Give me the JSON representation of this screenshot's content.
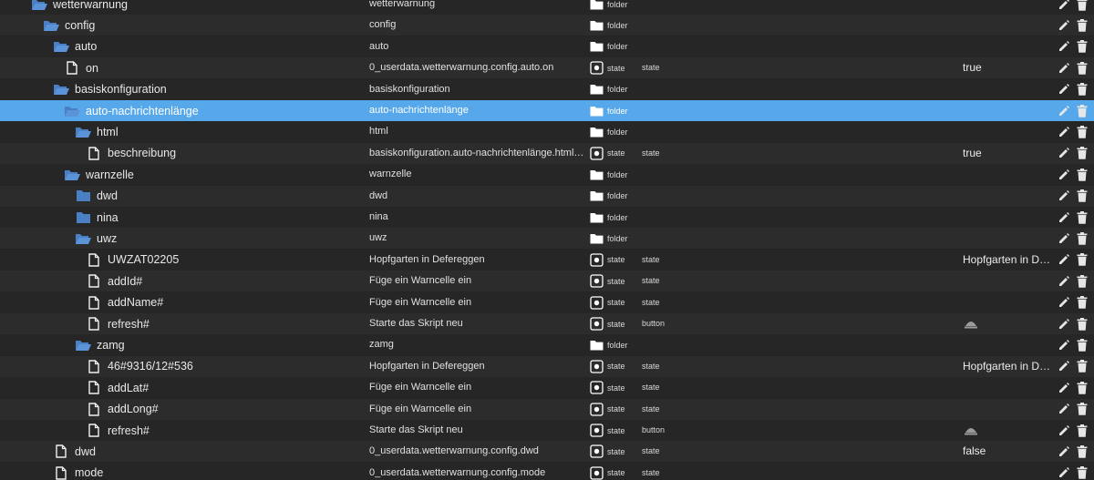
{
  "colors": {
    "background": "#242424",
    "row_alt": "#2c2c2c",
    "selected_row": "#57a8ea",
    "folder_icon": "#4a7fc4",
    "text": "#e6e6e6"
  },
  "rows": [
    {
      "name": "wetterwarnung",
      "depth": 0,
      "icon": "folder-open-icon",
      "id": "wetterwarnung",
      "type_label": "folder",
      "type_icon": "folder-icon",
      "role": "",
      "value": "",
      "value_icon": ""
    },
    {
      "name": "config",
      "depth": 1,
      "icon": "folder-open-icon",
      "id": "config",
      "type_label": "folder",
      "type_icon": "folder-icon",
      "role": "",
      "value": "",
      "value_icon": ""
    },
    {
      "name": "auto",
      "depth": 2,
      "icon": "folder-open-icon",
      "id": "auto",
      "type_label": "folder",
      "type_icon": "folder-icon",
      "role": "",
      "value": "",
      "value_icon": ""
    },
    {
      "name": "on",
      "depth": 3,
      "icon": "file-icon",
      "id": "0_userdata.wetterwarnung.config.auto.on",
      "type_label": "state",
      "type_icon": "state-icon",
      "role": "state",
      "value": "true",
      "value_icon": ""
    },
    {
      "name": "basiskonfiguration",
      "depth": 2,
      "icon": "folder-open-icon",
      "id": "basiskonfiguration",
      "type_label": "folder",
      "type_icon": "folder-icon",
      "role": "",
      "value": "",
      "value_icon": ""
    },
    {
      "name": "auto-nachrichtenlänge",
      "depth": 3,
      "icon": "folder-open-icon",
      "id": "auto-nachrichtenlänge",
      "type_label": "folder",
      "type_icon": "folder-icon",
      "role": "",
      "value": "",
      "value_icon": "",
      "selected": true
    },
    {
      "name": "html",
      "depth": 4,
      "icon": "folder-open-icon",
      "id": "html",
      "type_label": "folder",
      "type_icon": "folder-icon",
      "role": "",
      "value": "",
      "value_icon": ""
    },
    {
      "name": "beschreibung",
      "depth": 5,
      "icon": "file-icon",
      "id": "basiskonfiguration.auto-nachrichtenlänge.html.beschreibung",
      "type_label": "state",
      "type_icon": "state-icon",
      "role": "state",
      "value": "true",
      "value_icon": ""
    },
    {
      "name": "warnzelle",
      "depth": 3,
      "icon": "folder-open-icon",
      "id": "warnzelle",
      "type_label": "folder",
      "type_icon": "folder-icon",
      "role": "",
      "value": "",
      "value_icon": ""
    },
    {
      "name": "dwd",
      "depth": 4,
      "icon": "folder-closed-icon",
      "id": "dwd",
      "type_label": "folder",
      "type_icon": "folder-icon",
      "role": "",
      "value": "",
      "value_icon": ""
    },
    {
      "name": "nina",
      "depth": 4,
      "icon": "folder-closed-icon",
      "id": "nina",
      "type_label": "folder",
      "type_icon": "folder-icon",
      "role": "",
      "value": "",
      "value_icon": ""
    },
    {
      "name": "uwz",
      "depth": 4,
      "icon": "folder-open-icon",
      "id": "uwz",
      "type_label": "folder",
      "type_icon": "folder-icon",
      "role": "",
      "value": "",
      "value_icon": ""
    },
    {
      "name": "UWZAT02205",
      "depth": 5,
      "icon": "file-icon",
      "id": "Hopfgarten in Defereggen",
      "type_label": "state",
      "type_icon": "state-icon",
      "role": "state",
      "value": "Hopfgarten in Defereggen",
      "value_icon": ""
    },
    {
      "name": "addId#",
      "depth": 5,
      "icon": "file-icon",
      "id": "Füge ein Warncelle ein",
      "type_label": "state",
      "type_icon": "state-icon",
      "role": "state",
      "value": "",
      "value_icon": ""
    },
    {
      "name": "addName#",
      "depth": 5,
      "icon": "file-icon",
      "id": "Füge ein Warncelle ein",
      "type_label": "state",
      "type_icon": "state-icon",
      "role": "state",
      "value": "",
      "value_icon": ""
    },
    {
      "name": "refresh#",
      "depth": 5,
      "icon": "file-icon",
      "id": "Starte das Skript neu",
      "type_label": "state",
      "type_icon": "state-icon",
      "role": "button",
      "value": "",
      "value_icon": "bell-icon"
    },
    {
      "name": "zamg",
      "depth": 4,
      "icon": "folder-open-icon",
      "id": "zamg",
      "type_label": "folder",
      "type_icon": "folder-icon",
      "role": "",
      "value": "",
      "value_icon": ""
    },
    {
      "name": "46#9316/12#536",
      "depth": 5,
      "icon": "file-icon",
      "id": "Hopfgarten in Defereggen",
      "type_label": "state",
      "type_icon": "state-icon",
      "role": "state",
      "value": "Hopfgarten in Defereggen",
      "value_icon": ""
    },
    {
      "name": "addLat#",
      "depth": 5,
      "icon": "file-icon",
      "id": "Füge ein Warncelle ein",
      "type_label": "state",
      "type_icon": "state-icon",
      "role": "state",
      "value": "",
      "value_icon": ""
    },
    {
      "name": "addLong#",
      "depth": 5,
      "icon": "file-icon",
      "id": "Füge ein Warncelle ein",
      "type_label": "state",
      "type_icon": "state-icon",
      "role": "state",
      "value": "",
      "value_icon": ""
    },
    {
      "name": "refresh#",
      "depth": 5,
      "icon": "file-icon",
      "id": "Starte das Skript neu",
      "type_label": "state",
      "type_icon": "state-icon",
      "role": "button",
      "value": "",
      "value_icon": "bell-icon"
    },
    {
      "name": "dwd",
      "depth": 2,
      "icon": "file-icon",
      "id": "0_userdata.wetterwarnung.config.dwd",
      "type_label": "state",
      "type_icon": "state-icon",
      "role": "state",
      "value": "false",
      "value_icon": ""
    },
    {
      "name": "mode",
      "depth": 2,
      "icon": "file-icon",
      "id": "0_userdata.wetterwarnung.config.mode",
      "type_label": "state",
      "type_icon": "state-icon",
      "role": "state",
      "value": "",
      "value_icon": ""
    }
  ]
}
